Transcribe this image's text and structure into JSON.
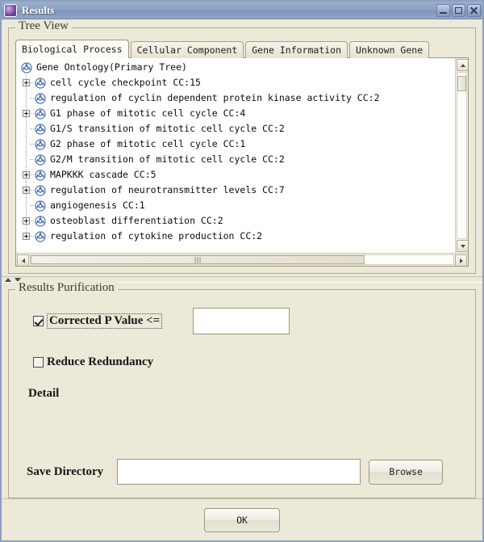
{
  "window": {
    "title": "Results",
    "icon": "app-icon",
    "controls": [
      {
        "name": "minimize-button",
        "label": "Minimize"
      },
      {
        "name": "maximize-button",
        "label": "Maximize"
      },
      {
        "name": "close-button",
        "label": "Close"
      }
    ]
  },
  "tree_view": {
    "legend": "Tree View",
    "tabs": [
      {
        "label": "Biological Process",
        "active": true
      },
      {
        "label": "Cellular Component",
        "active": false
      },
      {
        "label": "Gene Information",
        "active": false
      },
      {
        "label": "Unknown Gene",
        "active": false
      }
    ],
    "nodes": [
      {
        "label": "Gene Ontology(Primary Tree)",
        "level": 0,
        "expandable": false
      },
      {
        "label": "cell cycle checkpoint CC:15",
        "level": 1,
        "expandable": true
      },
      {
        "label": "regulation of cyclin dependent protein kinase activity CC:2",
        "level": 1,
        "expandable": false
      },
      {
        "label": "G1 phase of mitotic cell cycle CC:4",
        "level": 1,
        "expandable": true
      },
      {
        "label": "G1/S transition of mitotic cell cycle CC:2",
        "level": 1,
        "expandable": false
      },
      {
        "label": "G2 phase of mitotic cell cycle CC:1",
        "level": 1,
        "expandable": false
      },
      {
        "label": "G2/M transition of mitotic cell cycle CC:2",
        "level": 1,
        "expandable": false
      },
      {
        "label": "MAPKKK cascade CC:5",
        "level": 1,
        "expandable": true
      },
      {
        "label": "regulation of neurotransmitter levels CC:7",
        "level": 1,
        "expandable": true
      },
      {
        "label": "angiogenesis CC:1",
        "level": 1,
        "expandable": false
      },
      {
        "label": "osteoblast differentiation CC:2",
        "level": 1,
        "expandable": true
      },
      {
        "label": "regulation of cytokine production CC:2",
        "level": 1,
        "expandable": true
      }
    ],
    "scrollbars": {
      "vertical": {
        "thumb_top_pct": 2,
        "thumb_height_pct": 9
      },
      "horizontal": {
        "thumb_left_pct": 0,
        "thumb_width_pct": 79
      }
    }
  },
  "splitter": {
    "collapse_up": "collapse-up-arrow",
    "collapse_down": "collapse-down-arrow"
  },
  "purification": {
    "legend": "Results Purification",
    "corrected_p_value": {
      "label": "Corrected P Value <=",
      "checked": true,
      "value": "",
      "placeholder": ""
    },
    "reduce_redundancy": {
      "label": "Reduce Redundancy",
      "checked": false
    },
    "detail_label": "Detail",
    "save_directory": {
      "label": "Save Directory",
      "value": "",
      "placeholder": "",
      "browse_label": "Browse"
    }
  },
  "footer": {
    "ok_label": "OK"
  },
  "colors": {
    "title_bar": "#8da2c4",
    "window_bg": "#ece9d8",
    "panel_border": "#b0aa92",
    "tree_bg": "#ffffff",
    "node_icon": "#4a6fb5"
  }
}
